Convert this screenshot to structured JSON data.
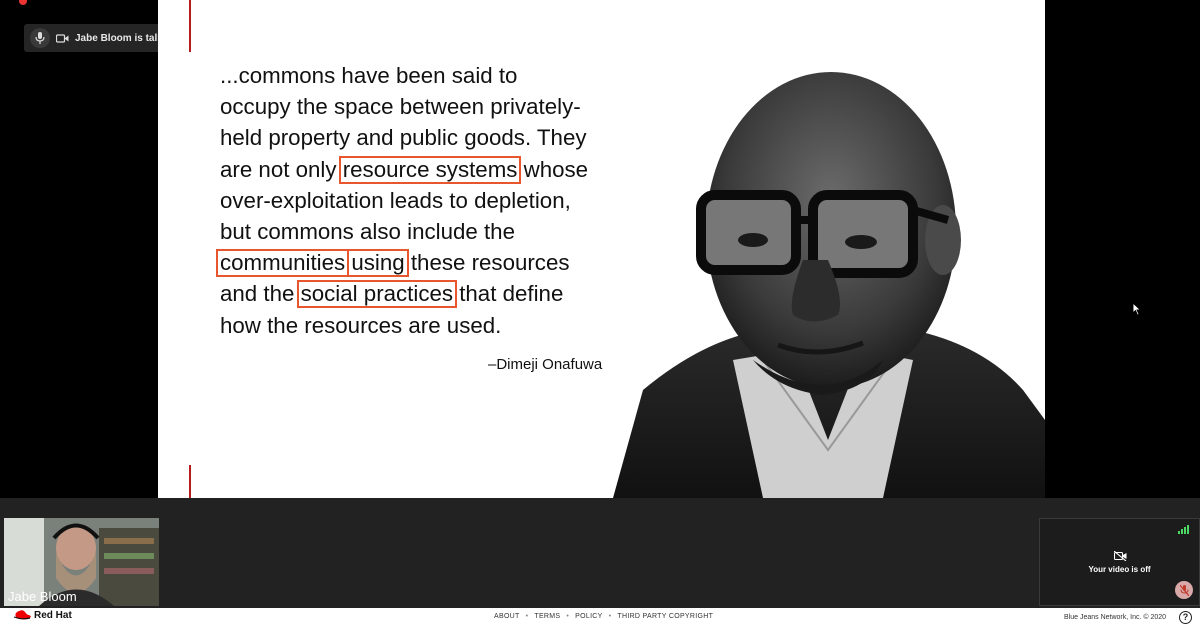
{
  "indicator": {
    "speaker_text": "Jabe Bloom is talking"
  },
  "slide": {
    "quote_lines": [
      "...commons have been said to",
      "occupy the space between privately-",
      "held property and public goods. They",
      [
        "are not only ",
        "resource systems",
        " whose"
      ],
      "over-exploitation leads to depletion,",
      "but commons also include the",
      [
        "",
        "communities",
        " ",
        "using",
        " these resources"
      ],
      [
        "and the ",
        "social practices",
        " that define"
      ],
      "how the resources are used."
    ],
    "highlights": [
      "resource systems",
      "communities",
      "using",
      "social practices"
    ],
    "attribution": "–Dimeji Onafuwa",
    "highlight_color": "#e8562e",
    "accent_line_color": "#b71c1c"
  },
  "participants": {
    "self": {
      "name": "Jabe Bloom"
    },
    "local": {
      "video_status": "Your video is off"
    }
  },
  "footer": {
    "brand": "Red Hat",
    "links": [
      "ABOUT",
      "TERMS",
      "POLICY",
      "THIRD PARTY COPYRIGHT"
    ],
    "copyright": "Blue Jeans Network, Inc. © 2020",
    "help": "?"
  },
  "icons": [
    "microphone-icon",
    "video-camera-icon",
    "video-off-icon",
    "mic-muted-icon",
    "signal-icon",
    "help-icon",
    "cursor-icon",
    "redhat-logo"
  ]
}
